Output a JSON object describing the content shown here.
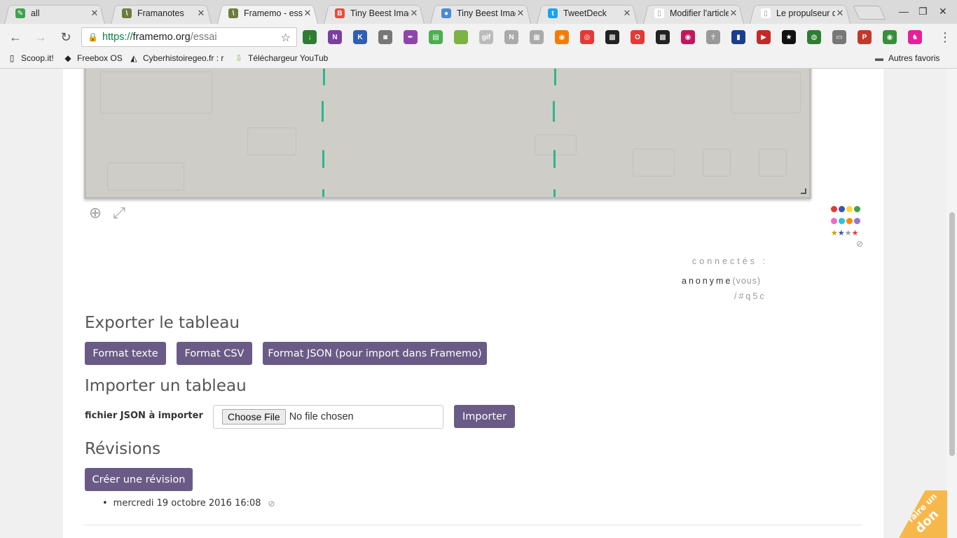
{
  "tabs": [
    {
      "title": "all",
      "fav_color": "#3fa34d",
      "fav_glyph": "✎"
    },
    {
      "title": "Framanotes",
      "fav_color": "#6e7b3f",
      "fav_glyph": "\\"
    },
    {
      "title": "Framemo - essai",
      "fav_color": "#6e7b3f",
      "fav_glyph": "\\"
    },
    {
      "title": "Tiny Beest Image",
      "fav_color": "#e84b3c",
      "fav_glyph": "B"
    },
    {
      "title": "Tiny Beest Image",
      "fav_color": "#4a8ad4",
      "fav_glyph": "●"
    },
    {
      "title": "TweetDeck",
      "fav_color": "#1da1f2",
      "fav_glyph": "t"
    },
    {
      "title": "Modifier l'article",
      "fav_color": "#999999",
      "fav_glyph": "▯"
    },
    {
      "title": "Le propulseur de",
      "fav_color": "#999999",
      "fav_glyph": "▯"
    }
  ],
  "window": {
    "minimize": "—",
    "restore": "❐",
    "close": "✕"
  },
  "toolbar": {
    "url_scheme": "https://",
    "url_host": "framemo.org",
    "url_path": "/essai",
    "back": "←",
    "forward": "→",
    "reload": "↻",
    "star": "☆",
    "lock": "🔒",
    "menu": "⋮"
  },
  "extensions": [
    {
      "icon": "download-icon",
      "color": "#2e7d32",
      "glyph": "↓"
    },
    {
      "icon": "onenote-icon",
      "color": "#7b3fa0",
      "glyph": "N"
    },
    {
      "icon": "k-icon",
      "color": "#2f5fb3",
      "glyph": "K"
    },
    {
      "icon": "camera-icon",
      "color": "#777777",
      "glyph": "◙"
    },
    {
      "icon": "feather-icon",
      "color": "#8e44ad",
      "glyph": "✒"
    },
    {
      "icon": "print-icon",
      "color": "#4caf50",
      "glyph": "▤"
    },
    {
      "icon": "circle-icon",
      "color": "#7cb342",
      "glyph": ""
    },
    {
      "icon": "gif-icon",
      "color": "#bbbbbb",
      "glyph": "gif"
    },
    {
      "icon": "notion-icon",
      "color": "#aaaaaa",
      "glyph": "N"
    },
    {
      "icon": "doc-icon",
      "color": "#aaaaaa",
      "glyph": "▦"
    },
    {
      "icon": "rss-icon",
      "color": "#f57c00",
      "glyph": "◉"
    },
    {
      "icon": "broadcast-icon",
      "color": "#e53935",
      "glyph": "◎"
    },
    {
      "icon": "qr-icon",
      "color": "#222222",
      "glyph": "▩"
    },
    {
      "icon": "opera-icon",
      "color": "#e53935",
      "glyph": "O"
    },
    {
      "icon": "qr2-icon",
      "color": "#222222",
      "glyph": "▩"
    },
    {
      "icon": "target-icon",
      "color": "#c2185b",
      "glyph": "◉"
    },
    {
      "icon": "ankh-icon",
      "color": "#999999",
      "glyph": "☥"
    },
    {
      "icon": "book-icon",
      "color": "#1a3d8f",
      "glyph": "▮"
    },
    {
      "icon": "video-icon",
      "color": "#c62828",
      "glyph": "▶"
    },
    {
      "icon": "star-icon",
      "color": "#111111",
      "glyph": "★"
    },
    {
      "icon": "turtle-icon",
      "color": "#2e7d32",
      "glyph": "◍"
    },
    {
      "icon": "cast-icon",
      "color": "#777777",
      "glyph": "▭"
    },
    {
      "icon": "pdf-icon",
      "color": "#c0392b",
      "glyph": "P"
    },
    {
      "icon": "eye-icon",
      "color": "#388e3c",
      "glyph": "◉"
    },
    {
      "icon": "elephant-icon",
      "color": "#e91e9b",
      "glyph": "♞"
    }
  ],
  "bookmarks": [
    {
      "label": "Scoop.it!",
      "icon": "page-icon",
      "glyph": "▯"
    },
    {
      "label": "Freebox OS",
      "icon": "freebox-icon",
      "glyph": "◆"
    },
    {
      "label": "Cyberhistoiregeo.fr : r",
      "icon": "wolf-icon",
      "glyph": "◭"
    },
    {
      "label": "Téléchargeur YouTub",
      "icon": "download-arrow-icon",
      "glyph": "⇩"
    }
  ],
  "other_bookmarks": {
    "label": "Autres favoris",
    "glyph": "▬"
  },
  "board_tools": {
    "add": "⊕",
    "expand": "⤢"
  },
  "palette": {
    "colors_row1": [
      "#e53935",
      "#3f51b5",
      "#fdd835",
      "#43a047"
    ],
    "colors_row2": [
      "#ec6bc9",
      "#26c6da",
      "#fb8c00",
      "#9575cd"
    ],
    "star_colors": [
      "#c8a000",
      "#3f51b5",
      "#9e9e9e",
      "#e53935"
    ],
    "star": "★",
    "ban": "⊘"
  },
  "users": {
    "label": "connectés :",
    "name": "anonyme",
    "you": "(vous)",
    "hash": "/#q5c"
  },
  "export": {
    "title": "Exporter le tableau",
    "btn_text": "Format texte",
    "btn_csv": "Format CSV",
    "btn_json": "Format JSON (pour import dans Framemo)"
  },
  "import": {
    "title": "Importer un tableau",
    "field_label": "fichier JSON à importer",
    "choose": "Choose File",
    "no_file": "No file chosen",
    "btn": "Importer"
  },
  "revisions": {
    "title": "Révisions",
    "btn": "Créer une révision",
    "items": [
      {
        "date": "mercredi 19 octobre 2016 16:08"
      }
    ],
    "bullet": "•",
    "ban": "⊘"
  },
  "donate": {
    "line1": "faire un",
    "line2": "don"
  }
}
